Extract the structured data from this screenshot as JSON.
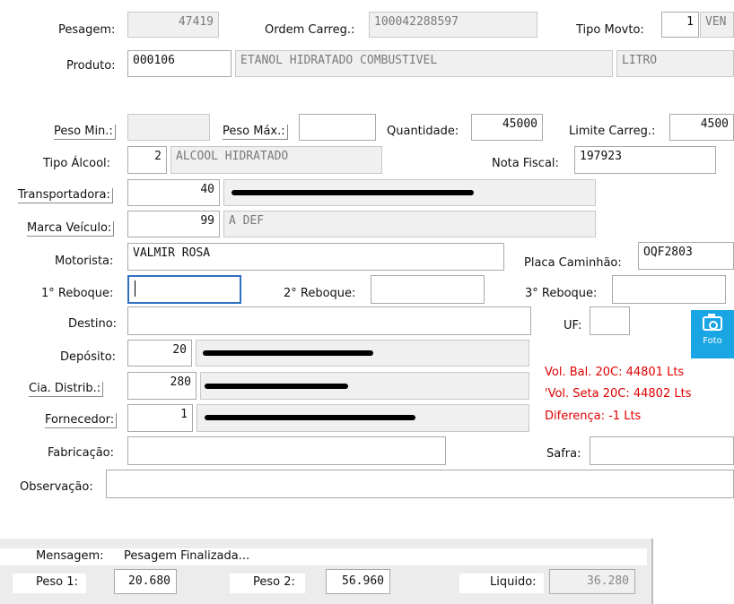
{
  "form": {
    "pesagem_label": "Pesagem:",
    "pesagem_value": "47419",
    "ordem_label": "Ordem Carreg.:",
    "ordem_value": "100042288597",
    "tipo_movto_label": "Tipo Movto:",
    "tipo_movto_code": "1",
    "tipo_movto_desc": "VEN",
    "produto_label": "Produto:",
    "produto_code": "000106",
    "produto_desc": "ETANOL HIDRATADO COMBUSTIVEL",
    "produto_unit": "LITRO",
    "peso_min_label": "Peso Min.:",
    "peso_min_value": "",
    "peso_max_label": "Peso Máx.:",
    "peso_max_value": "",
    "quantidade_label": "Quantidade:",
    "quantidade_value": "45000",
    "limite_label": "Limite Carreg.:",
    "limite_value": "4500",
    "tipo_alcool_label": "Tipo Álcool:",
    "tipo_alcool_code": "2",
    "tipo_alcool_desc": "ALCOOL HIDRATADO",
    "nota_fiscal_label": "Nota Fiscal:",
    "nota_fiscal_value": "197923",
    "transportadora_label": "Transportadora:",
    "transportadora_code": "40",
    "marca_label": "Marca Veículo:",
    "marca_code": "99",
    "marca_desc": "A DEF",
    "motorista_label": "Motorista:",
    "motorista_value": "VALMIR ROSA",
    "placa_label": "Placa Caminhão:",
    "placa_value": "OQF2803",
    "reboque1_label": "1° Reboque:",
    "reboque1_value": "",
    "reboque2_label": "2° Reboque:",
    "reboque2_value": "",
    "reboque3_label": "3° Reboque:",
    "reboque3_value": "",
    "destino_label": "Destino:",
    "destino_value": "",
    "uf_label": "UF:",
    "uf_value": "",
    "deposito_label": "Depósito:",
    "deposito_code": "20",
    "cia_label": "Cia. Distrib.:",
    "cia_code": "280",
    "fornecedor_label": "Fornecedor:",
    "fornecedor_code": "1",
    "fabricacao_label": "Fabricação:",
    "fabricacao_value": "",
    "safra_label": "Safra:",
    "safra_value": "",
    "observacao_label": "Observação:",
    "observacao_value": ""
  },
  "foto": {
    "label": "Foto",
    "icon": "camera-icon"
  },
  "volumes": {
    "vol_bal": "Vol. Bal. 20C: 44801 Lts",
    "vol_seta": "'Vol. Seta 20C: 44802 Lts",
    "diferenca": "Diferença: -1 Lts",
    "color": "#e00000"
  },
  "status": {
    "mensagem_label": "Mensagem:",
    "mensagem_value": "Pesagem Finalizada...",
    "peso1_label": "Peso 1:",
    "peso1_value": "20.680",
    "peso2_label": "Peso 2:",
    "peso2_value": "56.960",
    "liquido_label": "Liquido:",
    "liquido_value": "36.280"
  }
}
